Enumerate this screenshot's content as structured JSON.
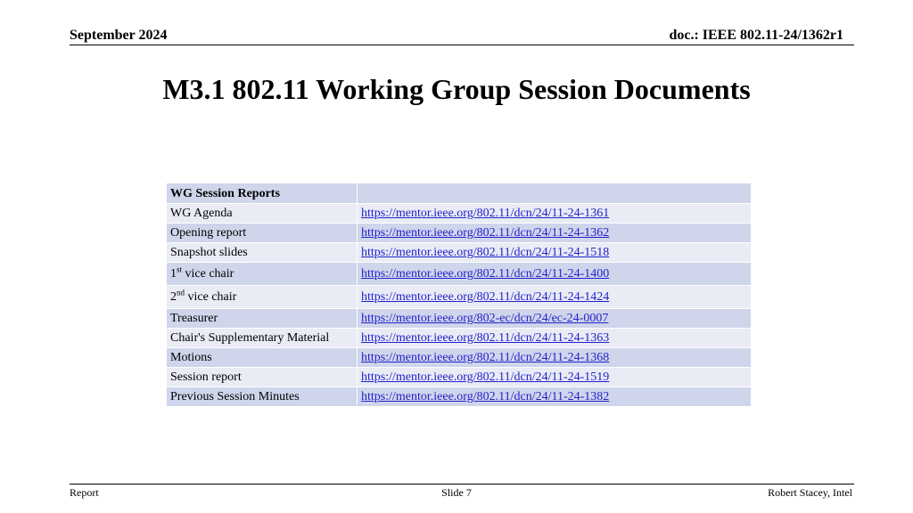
{
  "header": {
    "date": "September 2024",
    "doc_id": "doc.: IEEE 802.11-24/1362r1"
  },
  "title": "M3.1 802.11 Working Group Session Documents",
  "table": {
    "header": "WG Session Reports",
    "rows": [
      {
        "label": "WG Agenda",
        "link": "https://mentor.ieee.org/802.11/dcn/24/11-24-1361"
      },
      {
        "label": "Opening report",
        "link": "https://mentor.ieee.org/802.11/dcn/24/11-24-1362"
      },
      {
        "label": "Snapshot slides",
        "link": "https://mentor.ieee.org/802.11/dcn/24/11-24-1518"
      },
      {
        "label_prefix": "1",
        "label_sup": "st",
        "label_rest": " vice chair",
        "link": "https://mentor.ieee.org/802.11/dcn/24/11-24-1400"
      },
      {
        "label_prefix": "2",
        "label_sup": "nd",
        "label_rest": " vice chair",
        "link": "https://mentor.ieee.org/802.11/dcn/24/11-24-1424"
      },
      {
        "label": "Treasurer",
        "link": "https://mentor.ieee.org/802-ec/dcn/24/ec-24-0007"
      },
      {
        "label": "Chair's Supplementary Material",
        "link": "https://mentor.ieee.org/802.11/dcn/24/11-24-1363"
      },
      {
        "label": "Motions",
        "link": "https://mentor.ieee.org/802.11/dcn/24/11-24-1368"
      },
      {
        "label": "Session report",
        "link": "https://mentor.ieee.org/802.11/dcn/24/11-24-1519"
      },
      {
        "label": "Previous Session Minutes",
        "link": "https://mentor.ieee.org/802.11/dcn/24/11-24-1382"
      }
    ]
  },
  "footer": {
    "left": "Report",
    "center": "Slide 7",
    "right": "Robert Stacey, Intel"
  },
  "colors": {
    "table_header_bg": "#cfd5ea",
    "row_light": "#e9ebf5",
    "row_dark": "#cfd5ea",
    "link": "#2222cc"
  }
}
